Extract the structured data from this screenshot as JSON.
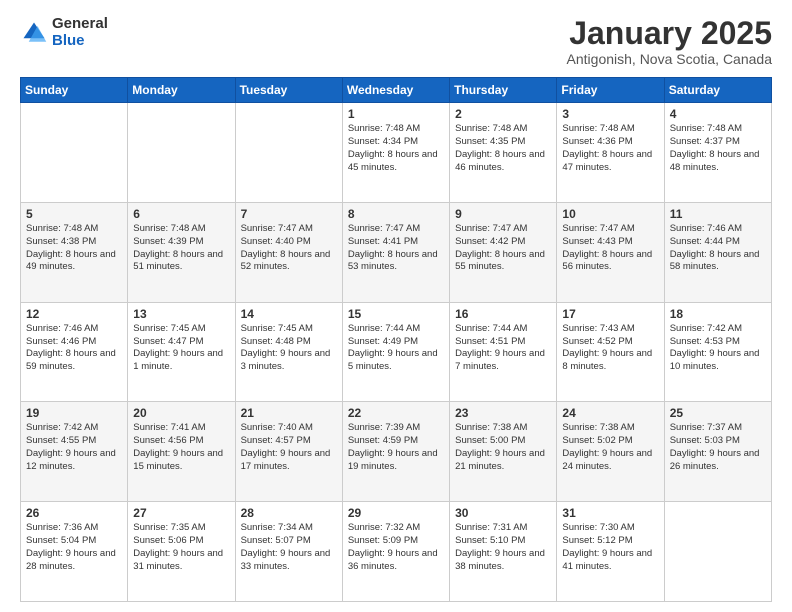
{
  "logo": {
    "general": "General",
    "blue": "Blue"
  },
  "title": "January 2025",
  "subtitle": "Antigonish, Nova Scotia, Canada",
  "weekdays": [
    "Sunday",
    "Monday",
    "Tuesday",
    "Wednesday",
    "Thursday",
    "Friday",
    "Saturday"
  ],
  "weeks": [
    [
      {
        "day": "",
        "sunrise": "",
        "sunset": "",
        "daylight": ""
      },
      {
        "day": "",
        "sunrise": "",
        "sunset": "",
        "daylight": ""
      },
      {
        "day": "",
        "sunrise": "",
        "sunset": "",
        "daylight": ""
      },
      {
        "day": "1",
        "sunrise": "Sunrise: 7:48 AM",
        "sunset": "Sunset: 4:34 PM",
        "daylight": "Daylight: 8 hours and 45 minutes."
      },
      {
        "day": "2",
        "sunrise": "Sunrise: 7:48 AM",
        "sunset": "Sunset: 4:35 PM",
        "daylight": "Daylight: 8 hours and 46 minutes."
      },
      {
        "day": "3",
        "sunrise": "Sunrise: 7:48 AM",
        "sunset": "Sunset: 4:36 PM",
        "daylight": "Daylight: 8 hours and 47 minutes."
      },
      {
        "day": "4",
        "sunrise": "Sunrise: 7:48 AM",
        "sunset": "Sunset: 4:37 PM",
        "daylight": "Daylight: 8 hours and 48 minutes."
      }
    ],
    [
      {
        "day": "5",
        "sunrise": "Sunrise: 7:48 AM",
        "sunset": "Sunset: 4:38 PM",
        "daylight": "Daylight: 8 hours and 49 minutes."
      },
      {
        "day": "6",
        "sunrise": "Sunrise: 7:48 AM",
        "sunset": "Sunset: 4:39 PM",
        "daylight": "Daylight: 8 hours and 51 minutes."
      },
      {
        "day": "7",
        "sunrise": "Sunrise: 7:47 AM",
        "sunset": "Sunset: 4:40 PM",
        "daylight": "Daylight: 8 hours and 52 minutes."
      },
      {
        "day": "8",
        "sunrise": "Sunrise: 7:47 AM",
        "sunset": "Sunset: 4:41 PM",
        "daylight": "Daylight: 8 hours and 53 minutes."
      },
      {
        "day": "9",
        "sunrise": "Sunrise: 7:47 AM",
        "sunset": "Sunset: 4:42 PM",
        "daylight": "Daylight: 8 hours and 55 minutes."
      },
      {
        "day": "10",
        "sunrise": "Sunrise: 7:47 AM",
        "sunset": "Sunset: 4:43 PM",
        "daylight": "Daylight: 8 hours and 56 minutes."
      },
      {
        "day": "11",
        "sunrise": "Sunrise: 7:46 AM",
        "sunset": "Sunset: 4:44 PM",
        "daylight": "Daylight: 8 hours and 58 minutes."
      }
    ],
    [
      {
        "day": "12",
        "sunrise": "Sunrise: 7:46 AM",
        "sunset": "Sunset: 4:46 PM",
        "daylight": "Daylight: 8 hours and 59 minutes."
      },
      {
        "day": "13",
        "sunrise": "Sunrise: 7:45 AM",
        "sunset": "Sunset: 4:47 PM",
        "daylight": "Daylight: 9 hours and 1 minute."
      },
      {
        "day": "14",
        "sunrise": "Sunrise: 7:45 AM",
        "sunset": "Sunset: 4:48 PM",
        "daylight": "Daylight: 9 hours and 3 minutes."
      },
      {
        "day": "15",
        "sunrise": "Sunrise: 7:44 AM",
        "sunset": "Sunset: 4:49 PM",
        "daylight": "Daylight: 9 hours and 5 minutes."
      },
      {
        "day": "16",
        "sunrise": "Sunrise: 7:44 AM",
        "sunset": "Sunset: 4:51 PM",
        "daylight": "Daylight: 9 hours and 7 minutes."
      },
      {
        "day": "17",
        "sunrise": "Sunrise: 7:43 AM",
        "sunset": "Sunset: 4:52 PM",
        "daylight": "Daylight: 9 hours and 8 minutes."
      },
      {
        "day": "18",
        "sunrise": "Sunrise: 7:42 AM",
        "sunset": "Sunset: 4:53 PM",
        "daylight": "Daylight: 9 hours and 10 minutes."
      }
    ],
    [
      {
        "day": "19",
        "sunrise": "Sunrise: 7:42 AM",
        "sunset": "Sunset: 4:55 PM",
        "daylight": "Daylight: 9 hours and 12 minutes."
      },
      {
        "day": "20",
        "sunrise": "Sunrise: 7:41 AM",
        "sunset": "Sunset: 4:56 PM",
        "daylight": "Daylight: 9 hours and 15 minutes."
      },
      {
        "day": "21",
        "sunrise": "Sunrise: 7:40 AM",
        "sunset": "Sunset: 4:57 PM",
        "daylight": "Daylight: 9 hours and 17 minutes."
      },
      {
        "day": "22",
        "sunrise": "Sunrise: 7:39 AM",
        "sunset": "Sunset: 4:59 PM",
        "daylight": "Daylight: 9 hours and 19 minutes."
      },
      {
        "day": "23",
        "sunrise": "Sunrise: 7:38 AM",
        "sunset": "Sunset: 5:00 PM",
        "daylight": "Daylight: 9 hours and 21 minutes."
      },
      {
        "day": "24",
        "sunrise": "Sunrise: 7:38 AM",
        "sunset": "Sunset: 5:02 PM",
        "daylight": "Daylight: 9 hours and 24 minutes."
      },
      {
        "day": "25",
        "sunrise": "Sunrise: 7:37 AM",
        "sunset": "Sunset: 5:03 PM",
        "daylight": "Daylight: 9 hours and 26 minutes."
      }
    ],
    [
      {
        "day": "26",
        "sunrise": "Sunrise: 7:36 AM",
        "sunset": "Sunset: 5:04 PM",
        "daylight": "Daylight: 9 hours and 28 minutes."
      },
      {
        "day": "27",
        "sunrise": "Sunrise: 7:35 AM",
        "sunset": "Sunset: 5:06 PM",
        "daylight": "Daylight: 9 hours and 31 minutes."
      },
      {
        "day": "28",
        "sunrise": "Sunrise: 7:34 AM",
        "sunset": "Sunset: 5:07 PM",
        "daylight": "Daylight: 9 hours and 33 minutes."
      },
      {
        "day": "29",
        "sunrise": "Sunrise: 7:32 AM",
        "sunset": "Sunset: 5:09 PM",
        "daylight": "Daylight: 9 hours and 36 minutes."
      },
      {
        "day": "30",
        "sunrise": "Sunrise: 7:31 AM",
        "sunset": "Sunset: 5:10 PM",
        "daylight": "Daylight: 9 hours and 38 minutes."
      },
      {
        "day": "31",
        "sunrise": "Sunrise: 7:30 AM",
        "sunset": "Sunset: 5:12 PM",
        "daylight": "Daylight: 9 hours and 41 minutes."
      },
      {
        "day": "",
        "sunrise": "",
        "sunset": "",
        "daylight": ""
      }
    ]
  ]
}
